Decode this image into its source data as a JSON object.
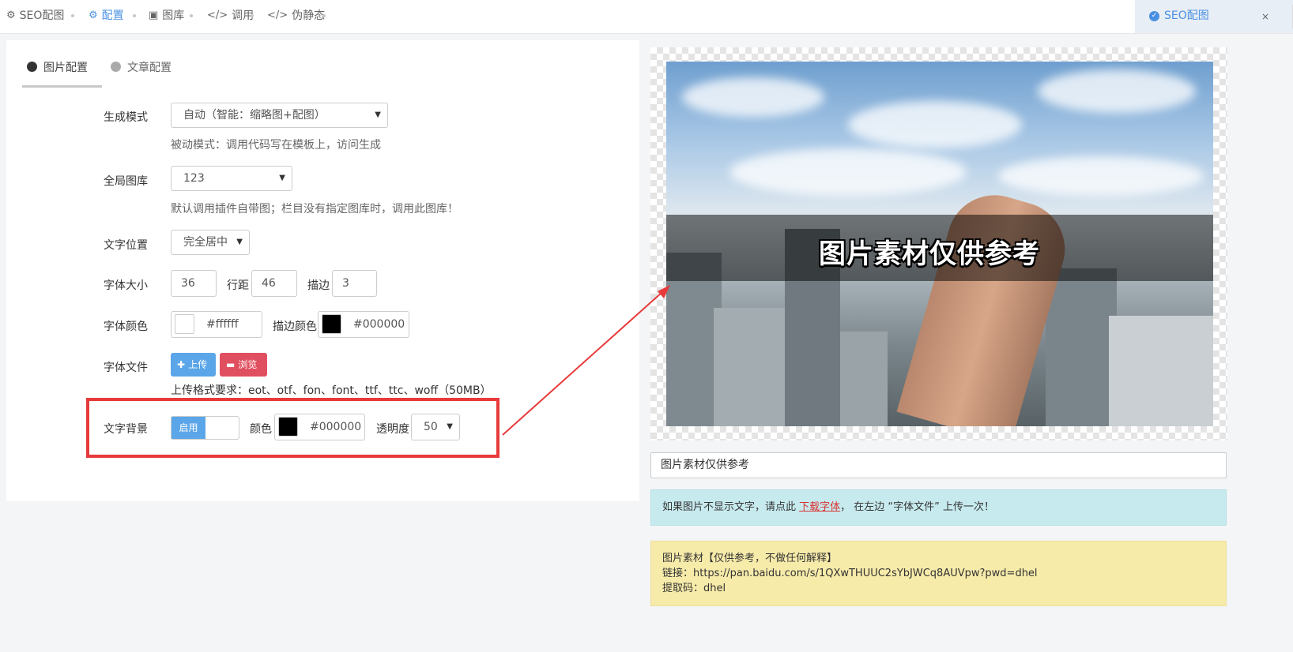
{
  "topnav": {
    "items": [
      {
        "label": "SEO配图",
        "icon": "gear-icon"
      },
      {
        "label": "配置",
        "icon": "gears-icon"
      },
      {
        "label": "图库",
        "icon": "image-icon"
      },
      {
        "label": "调用",
        "icon": "code-icon"
      },
      {
        "label": "伪静态",
        "icon": "code-icon"
      }
    ],
    "right_tab": {
      "label": "SEO配图",
      "close": "×",
      "icon": "check-circle-icon"
    }
  },
  "tabs": {
    "image_config": "图片配置",
    "article_config": "文章配置"
  },
  "form": {
    "mode": {
      "label": "生成模式",
      "value": "自动（智能：缩略图+配图）",
      "help": "被动模式：调用代码写在模板上，访问生成"
    },
    "gallery": {
      "label": "全局图库",
      "value": "123",
      "help": "默认调用插件自带图；栏目没有指定图库时，调用此图库！"
    },
    "text_position": {
      "label": "文字位置",
      "value": "完全居中"
    },
    "font_size": {
      "label": "字体大小",
      "value": "36",
      "line_height_label": "行距",
      "line_height_value": "46",
      "stroke_label": "描边",
      "stroke_value": "3"
    },
    "font_color": {
      "label": "字体颜色",
      "value": "#ffffff",
      "stroke_color_label": "描边颜色",
      "stroke_color_value": "#000000"
    },
    "font_file": {
      "label": "字体文件",
      "upload": "上传",
      "browse": "浏览",
      "help": "上传格式要求：eot、otf、fon、font、ttf、ttc、woff（50MB）"
    },
    "text_bg": {
      "label": "文字背景",
      "toggle_on": "启用",
      "color_label": "颜色",
      "color_value": "#000000",
      "opacity_label": "透明度",
      "opacity_value": "50"
    }
  },
  "preview": {
    "overlay_text": "图片素材仅供参考",
    "text_input": "图片素材仅供参考",
    "info": {
      "before": "如果图片不显示文字，请点此 ",
      "link": "下载字体",
      "after": "，  在左边 “字体文件” 上传一次！"
    },
    "notice": {
      "line1": "图片素材【仅供参考，不做任何解释】",
      "line2": "链接：https://pan.baidu.com/s/1QXwTHUUC2sYbJWCq8AUVpw?pwd=dhel",
      "line3": "提取码：dhel"
    }
  },
  "colors": {
    "accent": "#4a90e2",
    "highlight": "#e83a3a",
    "upload_button": "#5ba6e8",
    "browse_button": "#e04f5f"
  }
}
